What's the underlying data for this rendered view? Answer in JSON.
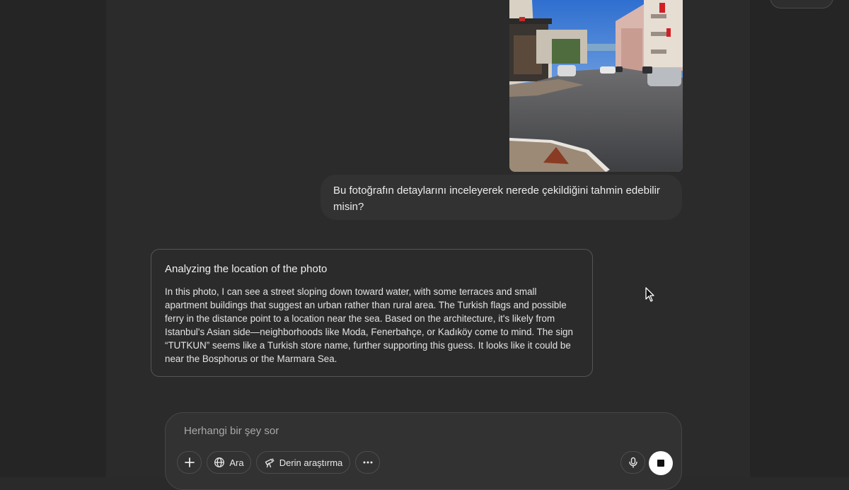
{
  "conversation": {
    "user_message": "Bu fotoğrafın detaylarını inceleyerek nerede çekildiğini tahmin edebilir misin?",
    "assistant": {
      "title": "Analyzing the location of the photo",
      "body": "In this photo, I can see a street sloping down toward water, with some terraces and small apartment buildings that suggest an urban rather than rural area. The Turkish flags and possible ferry in the distance point to a location near the sea. Based on the architecture, it's likely from Istanbul's Asian side—neighborhoods like Moda, Fenerbahçe, or Kadıköy come to mind. The sign “TUTKUN” seems like a Turkish store name, further supporting this guess. It looks like it could be near the Bosphorus or the Marmara Sea."
    }
  },
  "composer": {
    "placeholder": "Herhangi bir şey sor",
    "buttons": {
      "add_icon": "plus-icon",
      "search_label": "Ara",
      "search_icon": "globe-icon",
      "deep_research_label": "Derin araştırma",
      "deep_research_icon": "telescope-icon",
      "more_icon": "ellipsis-icon",
      "mic_icon": "microphone-icon",
      "stop_icon": "stop-icon"
    }
  },
  "colors": {
    "background": "#2a2a2a",
    "bubble": "#323232",
    "card_border": "#555555",
    "text": "#ececec",
    "placeholder": "#a8a8a8"
  }
}
